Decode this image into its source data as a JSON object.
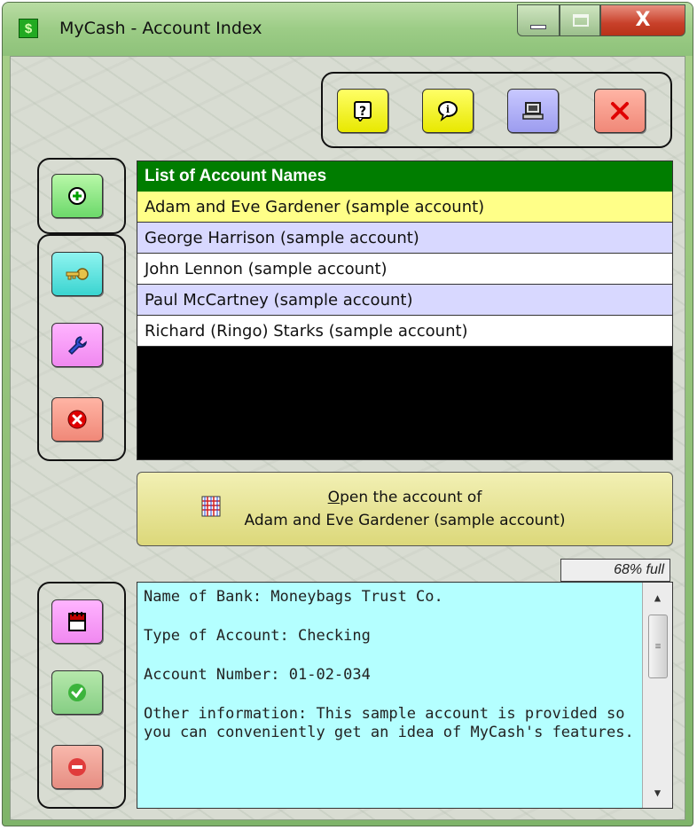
{
  "window": {
    "title": "MyCash - Account Index",
    "app_icon": "$",
    "close_glyph": "X"
  },
  "toolbar": {
    "buttons": [
      {
        "name": "help",
        "icon": "help-icon",
        "color": "#ffff44"
      },
      {
        "name": "info",
        "icon": "info-icon",
        "color": "#ffff44"
      },
      {
        "name": "computer",
        "icon": "computer-icon",
        "color": "#b0b0fa"
      },
      {
        "name": "exit",
        "icon": "close-icon",
        "color": "#f4a090"
      }
    ]
  },
  "account_list": {
    "header": "List of Account Names",
    "items": [
      {
        "label": "Adam and Eve Gardener (sample account)",
        "selected": true,
        "bg": "#ffff88"
      },
      {
        "label": "George Harrison (sample account)",
        "selected": false,
        "bg": "#d8d8ff"
      },
      {
        "label": "John Lennon (sample account)",
        "selected": false,
        "bg": "#ffffff"
      },
      {
        "label": "Paul McCartney (sample account)",
        "selected": false,
        "bg": "#d8d8ff"
      },
      {
        "label": "Richard (Ringo) Starks (sample account)",
        "selected": false,
        "bg": "#ffffff"
      }
    ]
  },
  "open_button": {
    "line1_underlined": "O",
    "line1_rest": "pen the account of",
    "line2": "Adam and Eve Gardener (sample account)"
  },
  "gauge": {
    "text": "68% full",
    "percent": 68
  },
  "info": {
    "bank": "Name of Bank: Moneybags Trust Co.",
    "type": "Type of Account: Checking",
    "number": "Account Number: 01-02-034",
    "other": "Other information:  This sample account is provided so you can conveniently get an idea of MyCash's features."
  },
  "colors": {
    "header_green": "#007d00",
    "selected_row": "#ffff88",
    "alt_row": "#d8d8ff",
    "info_bg": "#b4ffff"
  }
}
